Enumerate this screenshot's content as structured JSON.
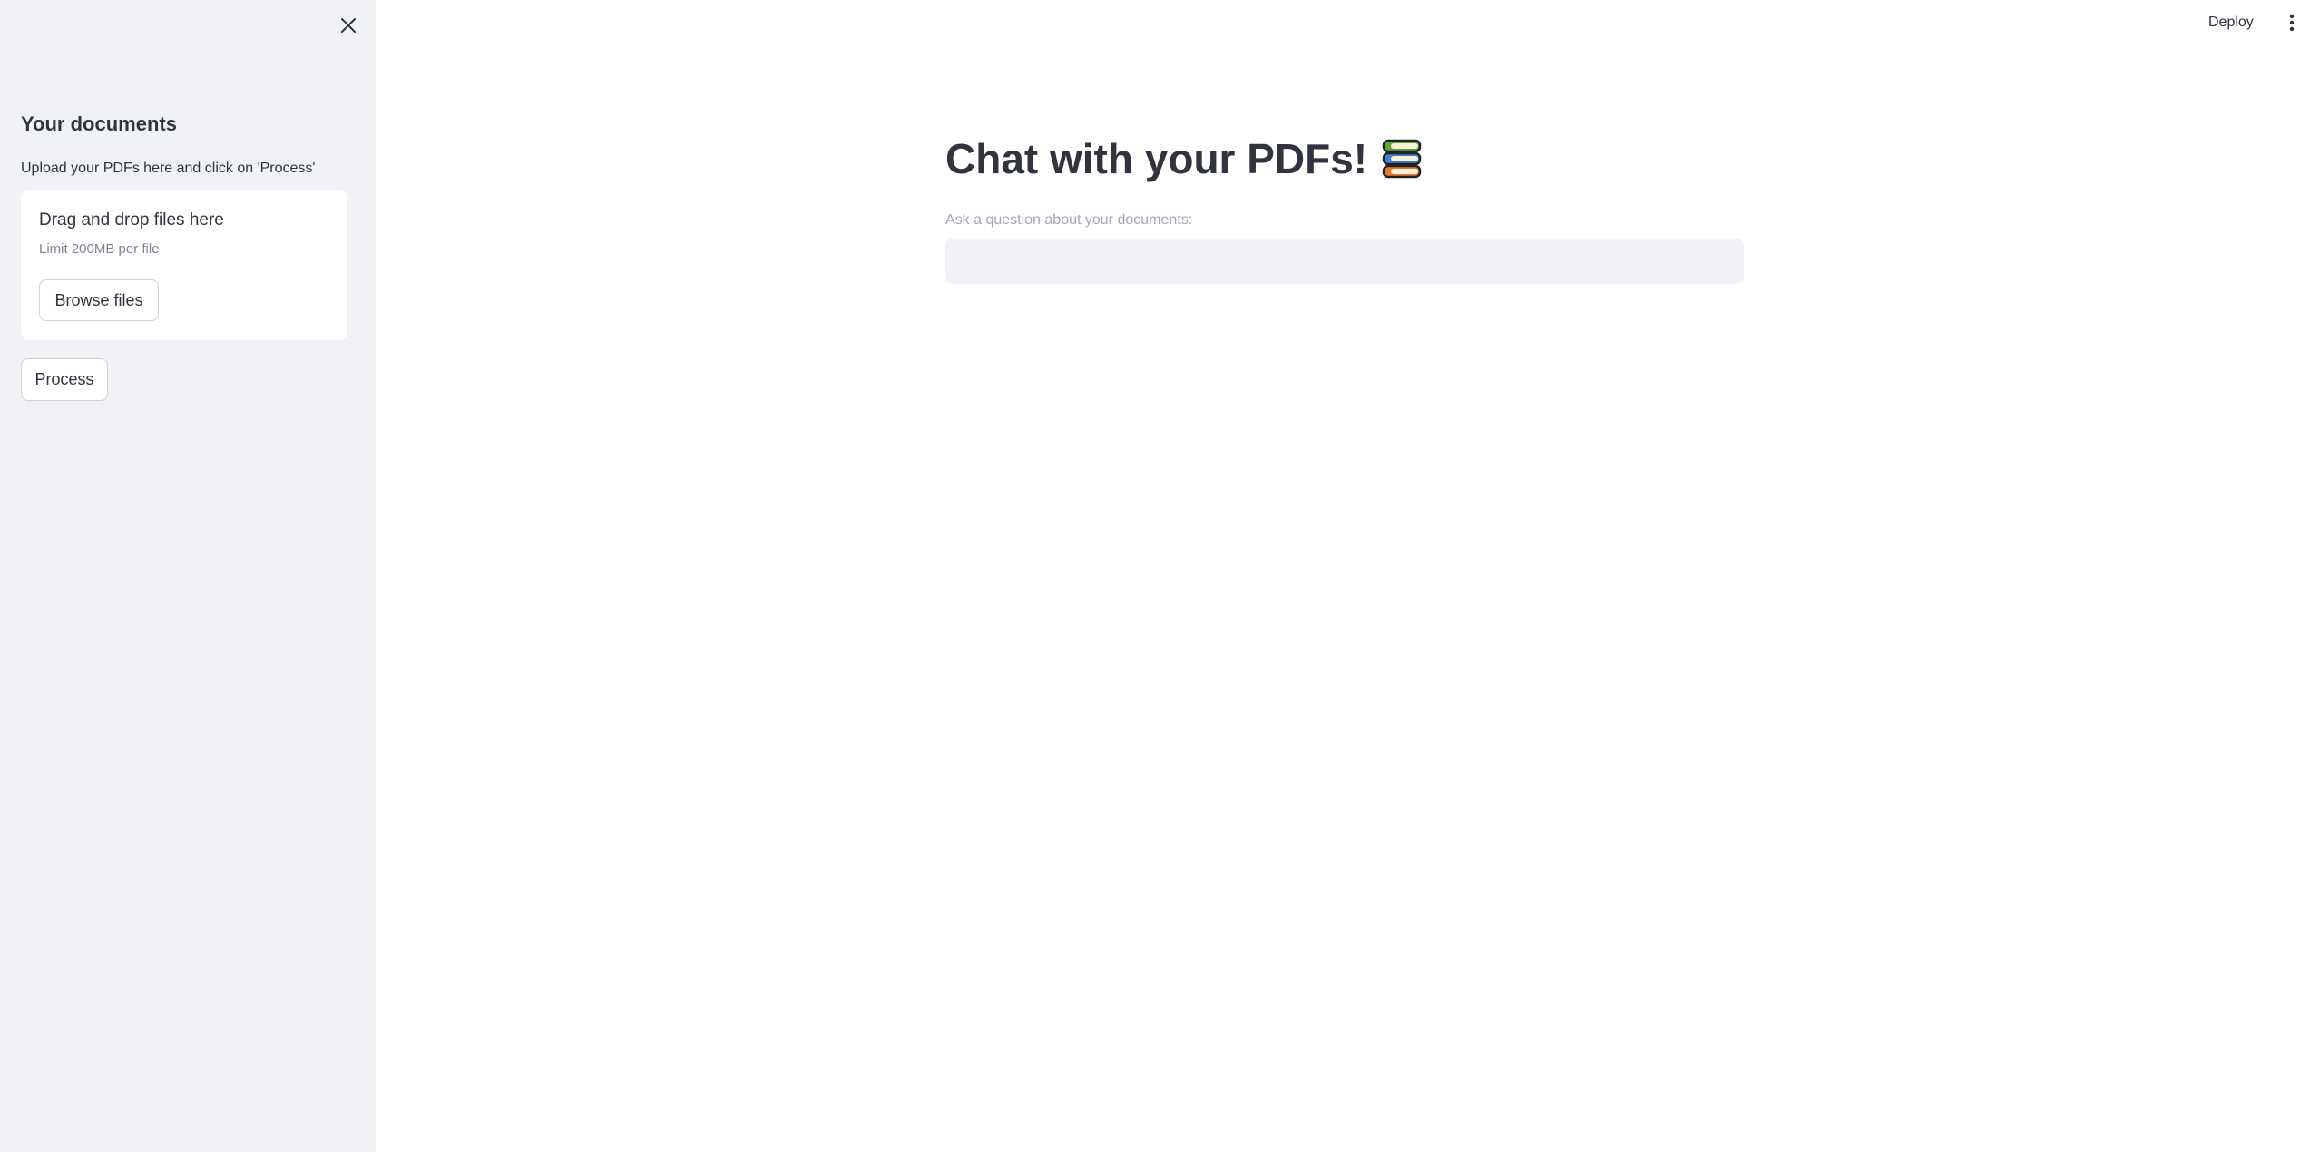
{
  "sidebar": {
    "close_icon": "close-icon",
    "heading": "Your documents",
    "caption": "Upload your PDFs here and click on 'Process'",
    "uploader": {
      "title": "Drag and drop files here",
      "limit": "Limit 200MB per file",
      "browse_label": "Browse files"
    },
    "process_label": "Process"
  },
  "header": {
    "deploy_label": "Deploy",
    "menu_icon": "more-vertical-icon"
  },
  "main": {
    "title": "Chat with your PDFs!",
    "title_icon": "books-icon",
    "question_label": "Ask a question about your documents:",
    "question_value": ""
  },
  "colors": {
    "sidebar_bg": "#f0f2f6",
    "text": "#31333f",
    "muted_text": "#808495",
    "input_bg": "#f0f2f6"
  }
}
